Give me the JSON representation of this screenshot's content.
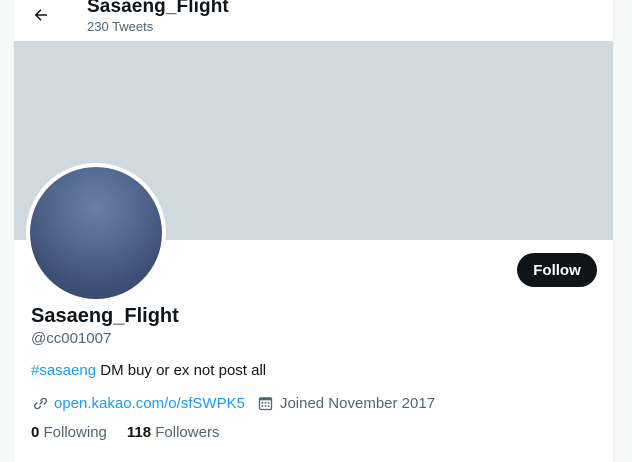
{
  "header": {
    "title": "Sasaeng_Flight",
    "tweet_count": "230 Tweets",
    "back_icon": "arrow-left-icon"
  },
  "banner": {
    "color": "#cfd9de"
  },
  "profile": {
    "display_name": "Sasaeng_Flight",
    "handle": "@cc001007",
    "follow_label": "Follow",
    "bio_hashtag": "#sasaeng",
    "bio_text": " DM buy or ex not post all",
    "link_icon": "link-icon",
    "link_text": "open.kakao.com/o/sfSWPK5",
    "calendar_icon": "calendar-icon",
    "joined": "Joined November 2017",
    "following_count": "0",
    "following_label": "Following",
    "followers_count": "118",
    "followers_label": "Followers"
  },
  "colors": {
    "accent": "#1d9bf0",
    "text": "#0f1419",
    "muted": "#536471",
    "follow_button": "#0f1419"
  }
}
